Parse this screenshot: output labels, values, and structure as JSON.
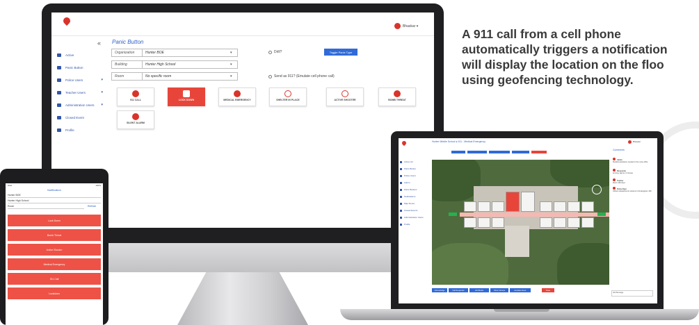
{
  "colors": {
    "brand_red": "#d9342b",
    "accent_blue": "#2f62c8",
    "headline": "#3a3a3a"
  },
  "headline": {
    "line1": "A 911 call from a cell phone",
    "line2": "automatically triggers a notification",
    "line3": "will display the location on the floo",
    "line4": "using geofencing technology."
  },
  "desktop": {
    "user_name": "Bhaskar",
    "collapse_icon": "«",
    "sidebar": [
      {
        "label": "Active",
        "icon": "list-icon"
      },
      {
        "label": "Panic Button",
        "icon": "hand-icon"
      },
      {
        "label": "Police Users",
        "icon": "users-icon"
      },
      {
        "label": "Teacher Users",
        "icon": "teacher-icon"
      },
      {
        "label": "Administration Users",
        "icon": "wrench-icon"
      },
      {
        "label": "Closed Event",
        "icon": "star-icon"
      },
      {
        "label": "Profile",
        "icon": "user-icon"
      }
    ],
    "page_title": "Panic Button",
    "fields": {
      "organization": {
        "label": "Organization",
        "value": "Hunter BOE"
      },
      "building": {
        "label": "Building",
        "value": "Hunter High School"
      },
      "room": {
        "label": "Room",
        "value": "No specific room"
      }
    },
    "drill_label": "Drill?",
    "send_label": "Send as 911?  (Emulate cell phone call)",
    "toggle_label": "Toggle Panic Type",
    "buttons": [
      {
        "label": "911 CALL",
        "icon": "phone-alert-icon"
      },
      {
        "label": "LOCK DOWN",
        "icon": "lock-icon",
        "active": true
      },
      {
        "label": "MEDICAL EMERGENCY",
        "icon": "medical-cross-icon"
      },
      {
        "label": "SHELTER IN PLACE",
        "icon": "house-icon"
      },
      {
        "label": "ACTIVE SHOOTER",
        "icon": "target-icon"
      },
      {
        "label": "BOMB THREAT",
        "icon": "bomb-icon"
      },
      {
        "label": "SILENT ALARM",
        "icon": "siren-icon"
      }
    ]
  },
  "tablet": {
    "status_left": "iPad",
    "status_right": "100%",
    "title": "Notification",
    "field1": "Hunter BOE",
    "field2": "Hunter High School",
    "field3": "Room",
    "field3_action": "Refresh",
    "buttons": [
      "Lock Down",
      "Bomb Threat",
      "Active Shooter",
      "Medical Emergency",
      "911 Call",
      "Lockdown"
    ]
  },
  "laptop": {
    "title": "Hunter Middle School  ● 911 - Medical Emergency",
    "user_name": "Bhaskar",
    "sidebar": [
      "Active (2)",
      "Panic Button",
      "Police Users",
      "Admin",
      "Panic Buttons",
      "Notifications",
      "Map Zones",
      "Closed Events",
      "Administration Users",
      "Profile"
    ],
    "right_heading": "Comments",
    "notes": [
      {
        "title": "Admin",
        "text": "Medical assistance needed in the nurse office"
      },
      {
        "title": "Responder",
        "text": "Arriving, approx 3 minutes"
      },
      {
        "title": "Teacher",
        "text": "Room 108 clear"
      },
      {
        "title": "Police Dept",
        "text": "Officers dispatched to student in Kindergarten 108"
      }
    ],
    "message_placeholder": "Add Message",
    "bottom_buttons": [
      "Acknowledge",
      "Call Responder",
      "Add Media",
      "Show Camera",
      "Escalate Event",
      "Close"
    ]
  }
}
